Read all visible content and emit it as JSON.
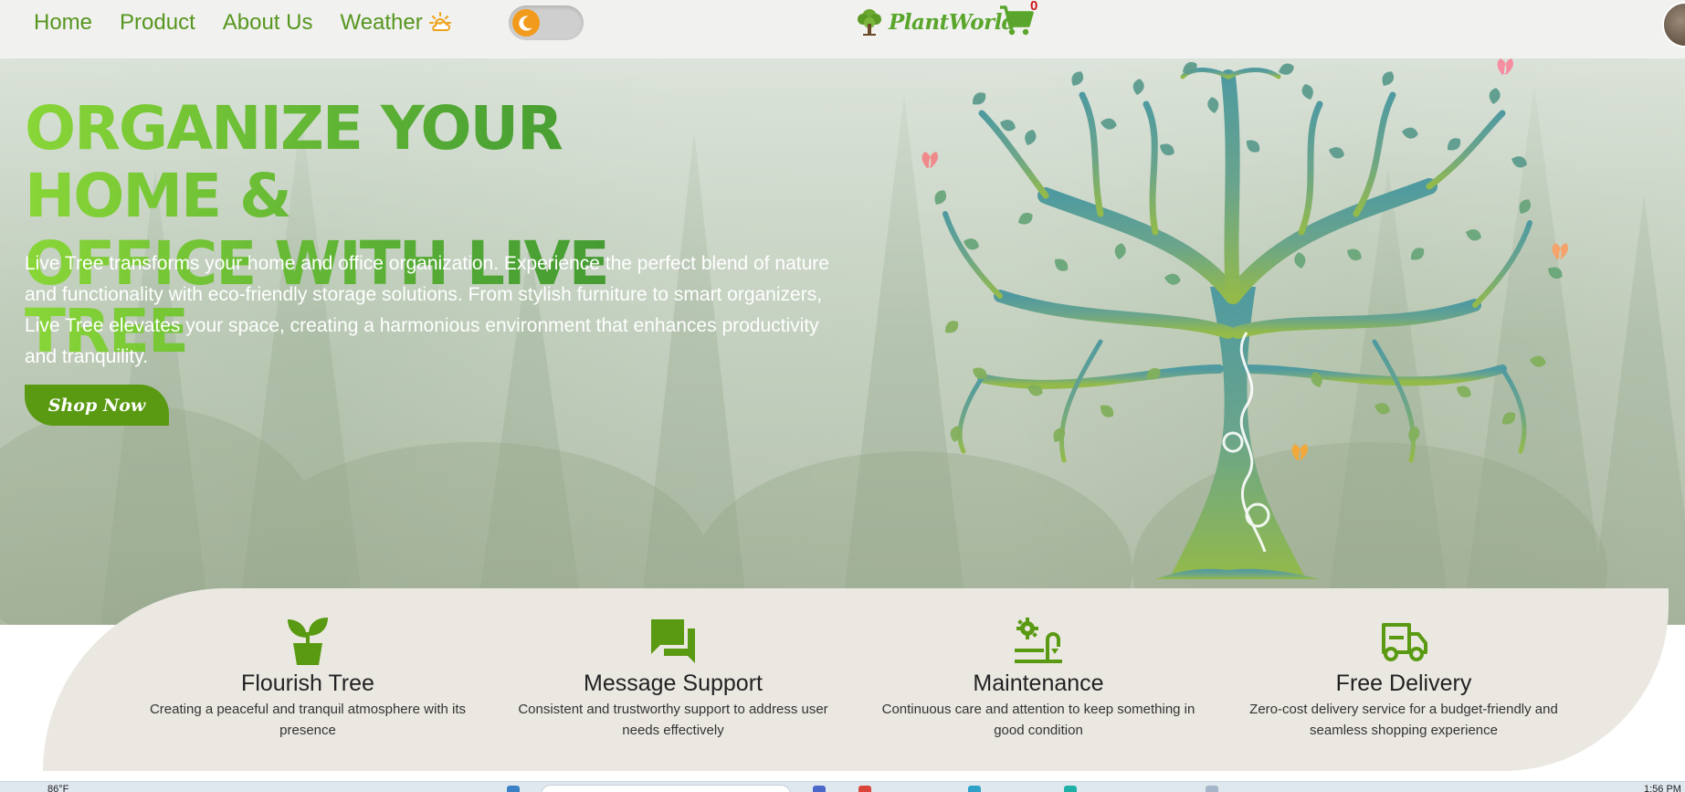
{
  "nav": {
    "links": [
      "Home",
      "Product",
      "About Us",
      "Weather"
    ],
    "weather_icon": "sun-cloud-icon",
    "toggle_icon": "moon-icon"
  },
  "brand": {
    "name": "PlantWorld",
    "logo_icon": "tree-logo-icon",
    "cart_icon": "shopping-cart-icon",
    "cart_count": "0"
  },
  "hero": {
    "title_line1": "ORGANIZE YOUR HOME &",
    "title_line2": "OFFICE WITH LIVE TREE",
    "description": "Live Tree transforms your home and office organization. Experience the perfect blend of nature and functionality with eco-friendly storage solutions. From stylish furniture to smart organizers, Live Tree elevates your space, creating a harmonious environment that enhances productivity and tranquility.",
    "cta_label": "Shop Now"
  },
  "features": [
    {
      "icon": "sprout-icon",
      "title": "Flourish Tree",
      "desc": "Creating a peaceful and tranquil atmosphere with its presence"
    },
    {
      "icon": "chat-icon",
      "title": "Message Support",
      "desc": "Consistent and trustworthy support to address user needs effectively"
    },
    {
      "icon": "maintenance-icon",
      "title": "Maintenance",
      "desc": "Continuous care and attention to keep something in good condition"
    },
    {
      "icon": "delivery-truck-icon",
      "title": "Free Delivery",
      "desc": "Zero-cost delivery service for a budget-friendly and seamless shopping experience"
    }
  ],
  "taskbar": {
    "weather": "86°F",
    "time": "1:56 PM"
  },
  "colors": {
    "accent": "#5a9a12",
    "nav_link": "#56961f",
    "brand": "#5aa62c",
    "features_bg": "#ebe8e2",
    "cart_badge": "#d0161c"
  }
}
